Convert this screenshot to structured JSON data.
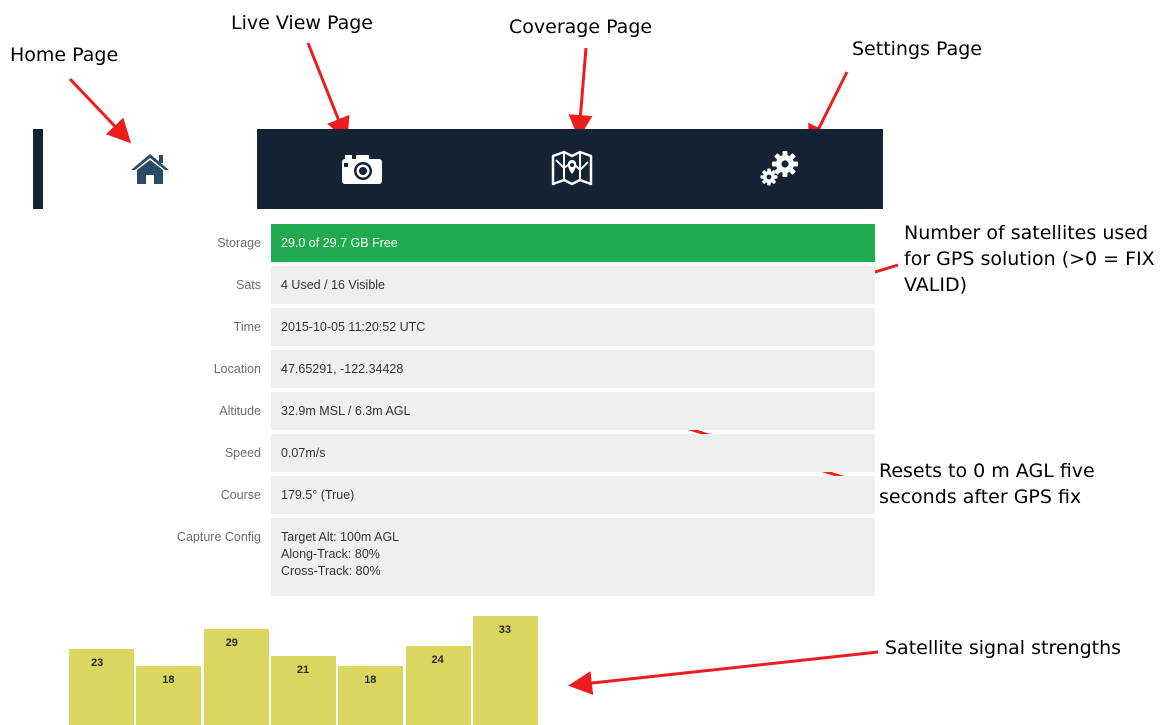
{
  "annotations": {
    "home_page": "Home Page",
    "live_view_page": "Live View Page",
    "coverage_page": "Coverage Page",
    "settings_page": "Settings Page",
    "sats_note_line1": "Number of satellites used",
    "sats_note_line2": "for GPS solution (>0 = FIX",
    "sats_note_line3": "VALID)",
    "agl_note_line1": "Resets to 0 m AGL five",
    "agl_note_line2": "seconds after GPS fix",
    "signal_note": "Satellite signal strengths"
  },
  "nav": {
    "items": [
      {
        "icon": "home-icon",
        "active": true
      },
      {
        "icon": "camera-icon",
        "active": false
      },
      {
        "icon": "map-icon",
        "active": false
      },
      {
        "icon": "gears-icon",
        "active": false
      }
    ],
    "colors": {
      "bar": "#142435",
      "active_icon": "#2c4a66",
      "icon": "#ffffff"
    }
  },
  "status": {
    "storage": {
      "label": "Storage",
      "value": "29.0 of 29.7 GB Free"
    },
    "sats": {
      "label": "Sats",
      "value": "4 Used / 16 Visible"
    },
    "time": {
      "label": "Time",
      "value": "2015-10-05 11:20:52 UTC"
    },
    "location": {
      "label": "Location",
      "value": "47.65291, -122.34428"
    },
    "altitude": {
      "label": "Altitude",
      "value": "32.9m MSL / 6.3m AGL"
    },
    "speed": {
      "label": "Speed",
      "value": "0.07m/s"
    },
    "course": {
      "label": "Course",
      "value": "179.5° (True)"
    },
    "capture_config": {
      "label": "Capture Config",
      "lines": [
        "Target Alt: 100m AGL",
        "Along-Track: 80%",
        "Cross-Track: 80%"
      ]
    }
  },
  "colors": {
    "storage_ok": "#21ab4e",
    "row_bg": "#efefef",
    "bar": "#d9d75f",
    "arrow": "#ee1c1c"
  },
  "signal_bars": {
    "values": [
      23,
      18,
      29,
      21,
      18,
      24,
      33
    ],
    "labels": [
      "23",
      "18",
      "29",
      "21",
      "18",
      "24",
      "33"
    ]
  }
}
